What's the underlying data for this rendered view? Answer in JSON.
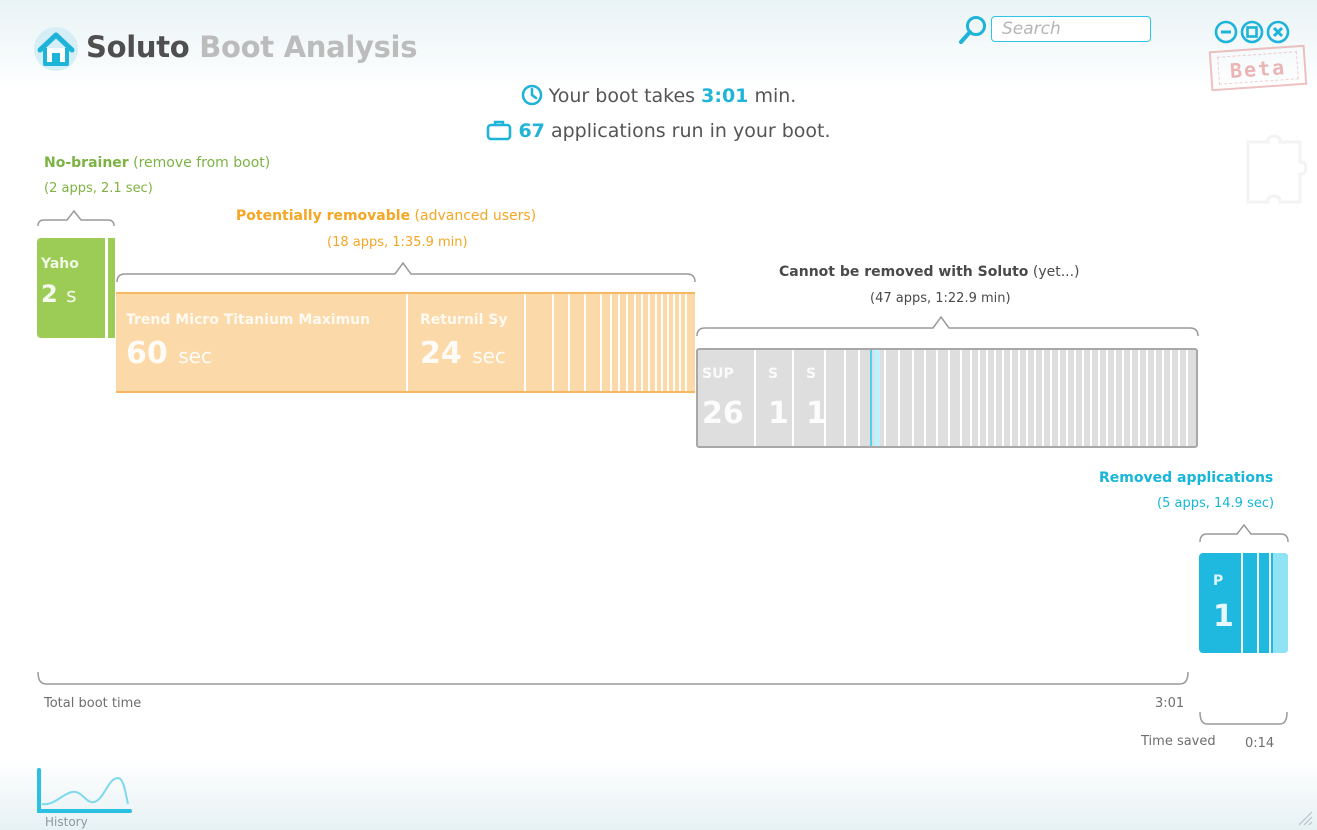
{
  "header": {
    "app_name": "Soluto",
    "app_subtitle": "Boot Analysis",
    "search_placeholder": "Search",
    "stamp_text": "Beta"
  },
  "summary": {
    "boot_prefix": "Your boot takes",
    "boot_time": "3:01",
    "boot_suffix": "min.",
    "app_count": "67",
    "apps_suffix": "applications run in your boot."
  },
  "groups": {
    "no_brainer": {
      "title": "No-brainer",
      "qualifier": "(remove from boot)",
      "stats": "(2 apps, 2.1 sec)",
      "apps": [
        {
          "name": "Yaho",
          "time": "2",
          "unit": "s"
        }
      ]
    },
    "potentially_removable": {
      "title": "Potentially removable",
      "qualifier": "(advanced users)",
      "stats": "(18 apps, 1:35.9 min)",
      "apps": [
        {
          "name": "Trend Micro Titanium Maximun",
          "time": "60",
          "unit": "sec"
        },
        {
          "name": "Returnil Sy",
          "time": "24",
          "unit": "sec"
        }
      ]
    },
    "cannot_remove": {
      "title": "Cannot be removed with Soluto",
      "qualifier": "(yet...)",
      "stats": "(47 apps, 1:22.9 min)",
      "apps": [
        {
          "name": "SUP",
          "time": "26"
        },
        {
          "name": "S",
          "time": "1"
        },
        {
          "name": "S",
          "time": "1"
        }
      ]
    },
    "removed": {
      "title": "Removed applications",
      "stats": "(5 apps, 14.9 sec)",
      "apps": [
        {
          "name": "P",
          "time": "1"
        }
      ]
    }
  },
  "timeline": {
    "total_label": "Total boot time",
    "total_value": "3:01",
    "saved_label": "Time saved",
    "saved_value": "0:14"
  },
  "footer": {
    "history_label": "History"
  },
  "colors": {
    "accent": "#1fb4d8",
    "no_brainer": "#9ccc56",
    "potentially_removable": "#fcd9a8",
    "cannot_remove": "#dedede",
    "removed": "#1fb8de"
  }
}
